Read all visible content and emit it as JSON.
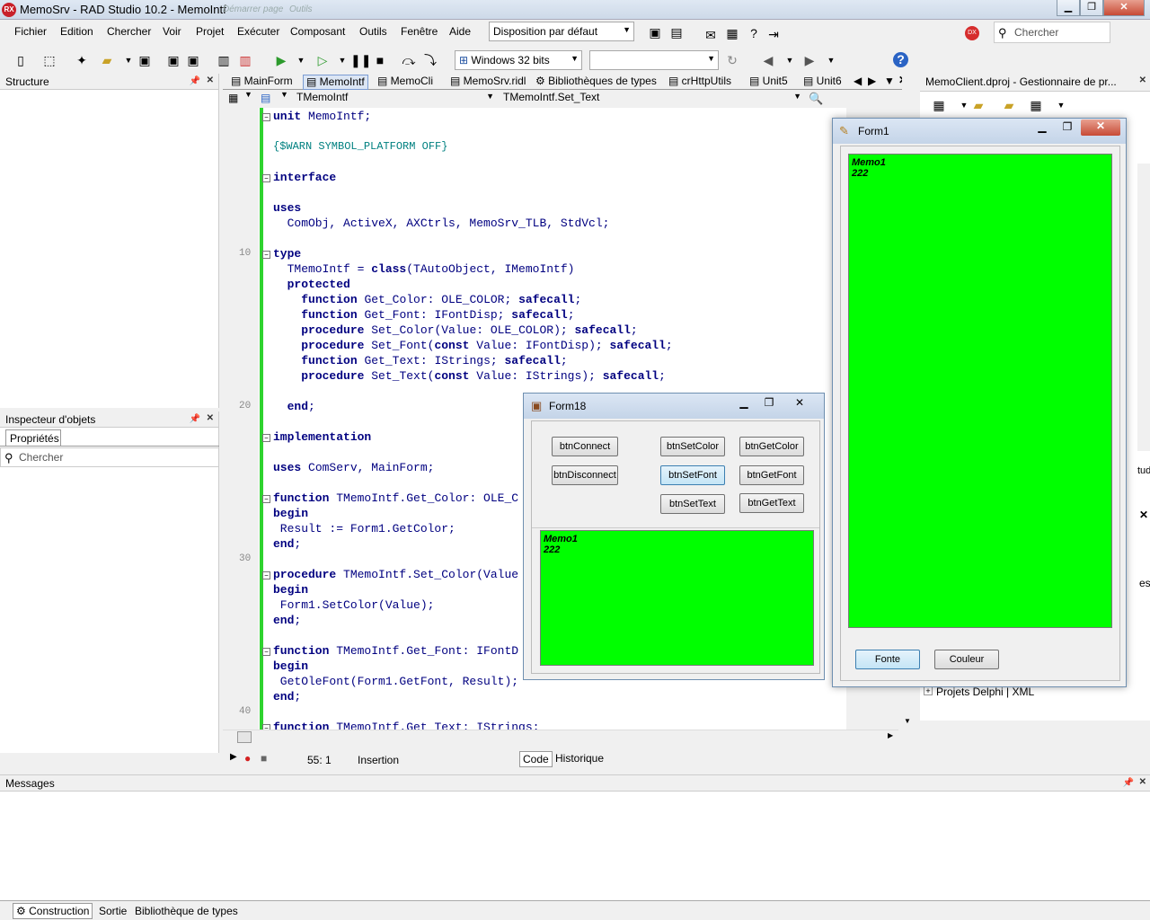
{
  "app": {
    "title": "MemoSrv - RAD Studio 10.2 - MemoIntf",
    "ghost_text_1": "Démarrer page",
    "ghost_text_2": "Outils"
  },
  "menu": [
    "Fichier",
    "Edition",
    "Chercher",
    "Voir",
    "Projet",
    "Exécuter",
    "Composant",
    "Outils",
    "Fenêtre",
    "Aide"
  ],
  "layout_combo": "Disposition par défaut",
  "search_placeholder": "Chercher",
  "platform_combo": "Windows 32 bits",
  "structure_panel": {
    "title": "Structure"
  },
  "inspector": {
    "title": "Inspecteur d'objets",
    "tab": "Propriétés",
    "search_placeholder": "Chercher"
  },
  "doc_tabs": [
    "MainForm",
    "MemoIntf",
    "MemoCli",
    "MemoSrv.ridl",
    "Bibliothèques de types",
    "crHttpUtils",
    "Unit5",
    "Unit6"
  ],
  "class_combo": "TMemoIntf",
  "method_combo": "TMemoIntf.Set_Text",
  "code_lines": [
    "unit MemoIntf;",
    "",
    "{$WARN SYMBOL_PLATFORM OFF}",
    "",
    "interface",
    "",
    "uses",
    "  ComObj, ActiveX, AXCtrls, MemoSrv_TLB, StdVcl;",
    "",
    "type",
    "  TMemoIntf = class(TAutoObject, IMemoIntf)",
    "  protected",
    "    function Get_Color: OLE_COLOR; safecall;",
    "    function Get_Font: IFontDisp; safecall;",
    "    procedure Set_Color(Value: OLE_COLOR); safecall;",
    "    procedure Set_Font(const Value: IFontDisp); safecall;",
    "    function Get_Text: IStrings; safecall;",
    "    procedure Set_Text(const Value: IStrings); safecall;",
    "",
    "  end;",
    "",
    "implementation",
    "",
    "uses ComServ, MainForm;",
    "",
    "function TMemoIntf.Get_Color: OLE_C",
    "begin",
    " Result := Form1.GetColor;",
    "end;",
    "",
    "procedure TMemoIntf.Set_Color(Value",
    "begin",
    " Form1.SetColor(Value);",
    "end;",
    "",
    "function TMemoIntf.Get_Font: IFontD",
    "begin",
    " GetOleFont(Form1.GetFont, Result);",
    "end;",
    "",
    "function TMemoIntf.Get_Text: IStrings;"
  ],
  "line_numbers": [
    "10",
    "20",
    "30",
    "40"
  ],
  "status": {
    "position": "55:  1",
    "mode": "Insertion",
    "tab_code": "Code",
    "tab_history": "Historique"
  },
  "project_manager": {
    "title": "MemoClient.dproj - Gestionnaire de pr...",
    "projects_label": "Projets Delphi | XML",
    "cut_text_1": "tudio",
    "cut_text_2": "es"
  },
  "form18": {
    "title": "Form18",
    "buttons": {
      "connect": "btnConnect",
      "disconnect": "btnDisconnect",
      "set_color": "btnSetColor",
      "get_color": "btnGetColor",
      "set_font": "btnSetFont",
      "get_font": "btnGetFont",
      "set_text": "btnSetText",
      "get_text": "btnGetText"
    },
    "memo_lines": [
      "Memo1",
      "222"
    ]
  },
  "form1": {
    "title": "Form1",
    "memo_lines": [
      "Memo1",
      "222"
    ],
    "btn_font": "Fonte",
    "btn_color": "Couleur"
  },
  "messages": {
    "title": "Messages"
  },
  "bottom_tabs": [
    "Construction",
    "Sortie",
    "Bibliothèque de types"
  ],
  "colors": {
    "memo_bg": "#00ff00",
    "gutter_change": "#2fd32f",
    "keyword": "#000080"
  }
}
